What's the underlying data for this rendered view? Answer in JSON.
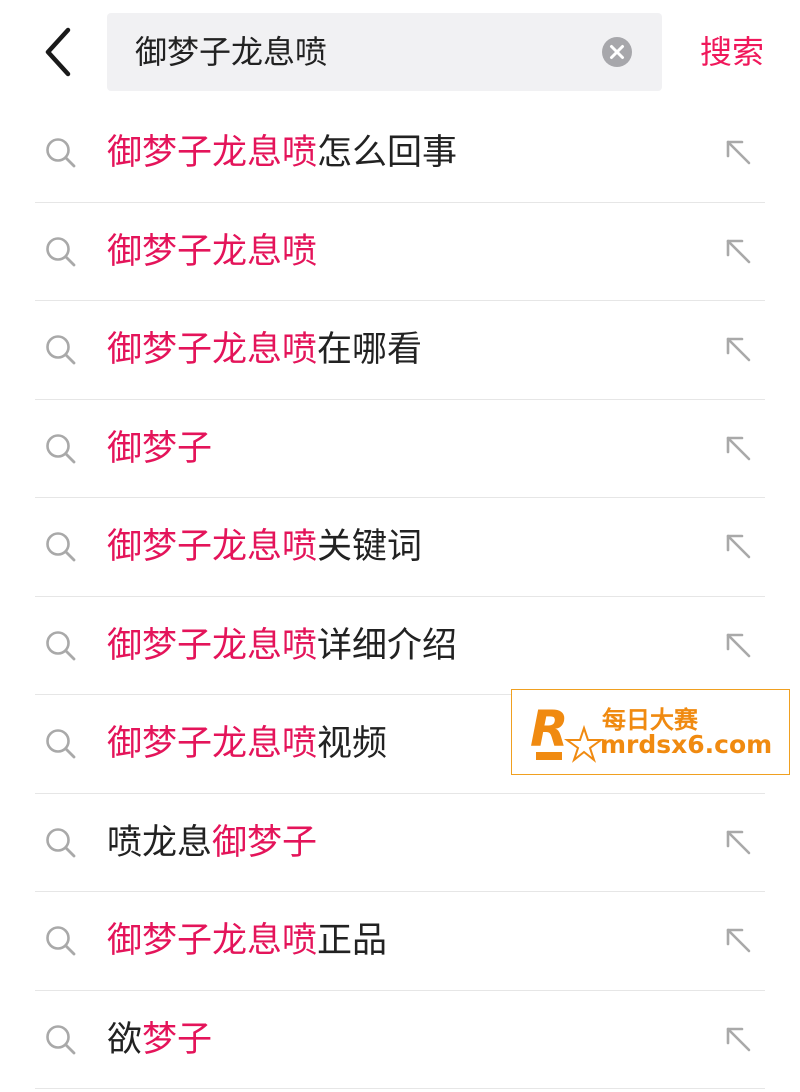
{
  "header": {
    "query": "御梦子龙息喷",
    "search_label": "搜索"
  },
  "suggestions": [
    {
      "parts": [
        {
          "text": "御梦子龙息喷",
          "hl": true
        },
        {
          "text": "怎么回事",
          "hl": false
        }
      ]
    },
    {
      "parts": [
        {
          "text": "御梦子龙息喷",
          "hl": true
        }
      ]
    },
    {
      "parts": [
        {
          "text": "御梦子龙息喷",
          "hl": true
        },
        {
          "text": "在哪看",
          "hl": false
        }
      ]
    },
    {
      "parts": [
        {
          "text": "御梦子",
          "hl": true
        }
      ]
    },
    {
      "parts": [
        {
          "text": "御梦子龙息喷",
          "hl": true
        },
        {
          "text": "关键词",
          "hl": false
        }
      ]
    },
    {
      "parts": [
        {
          "text": "御梦子龙息喷",
          "hl": true
        },
        {
          "text": "详细介绍",
          "hl": false
        }
      ]
    },
    {
      "parts": [
        {
          "text": "御梦子龙息喷",
          "hl": true
        },
        {
          "text": "视频",
          "hl": false
        }
      ]
    },
    {
      "parts": [
        {
          "text": "喷龙息",
          "hl": false
        },
        {
          "text": "御梦子",
          "hl": true
        }
      ]
    },
    {
      "parts": [
        {
          "text": "御梦子龙息喷",
          "hl": true
        },
        {
          "text": "正品",
          "hl": false
        }
      ]
    },
    {
      "parts": [
        {
          "text": "欲",
          "hl": false
        },
        {
          "text": "梦子",
          "hl": true
        }
      ]
    }
  ],
  "watermark": {
    "name": "每日大赛",
    "url": "mrdsx6.com"
  },
  "colors": {
    "accent": "#f0185b",
    "highlight": "#e4145a",
    "text": "#222222",
    "icon_gray": "#a9a9a9",
    "divider": "#e6e6e6"
  },
  "icons": {
    "back": "chevron-left-icon",
    "clear": "clear-circle-icon",
    "suggestion": "search-icon",
    "fill": "arrow-up-left-icon"
  }
}
